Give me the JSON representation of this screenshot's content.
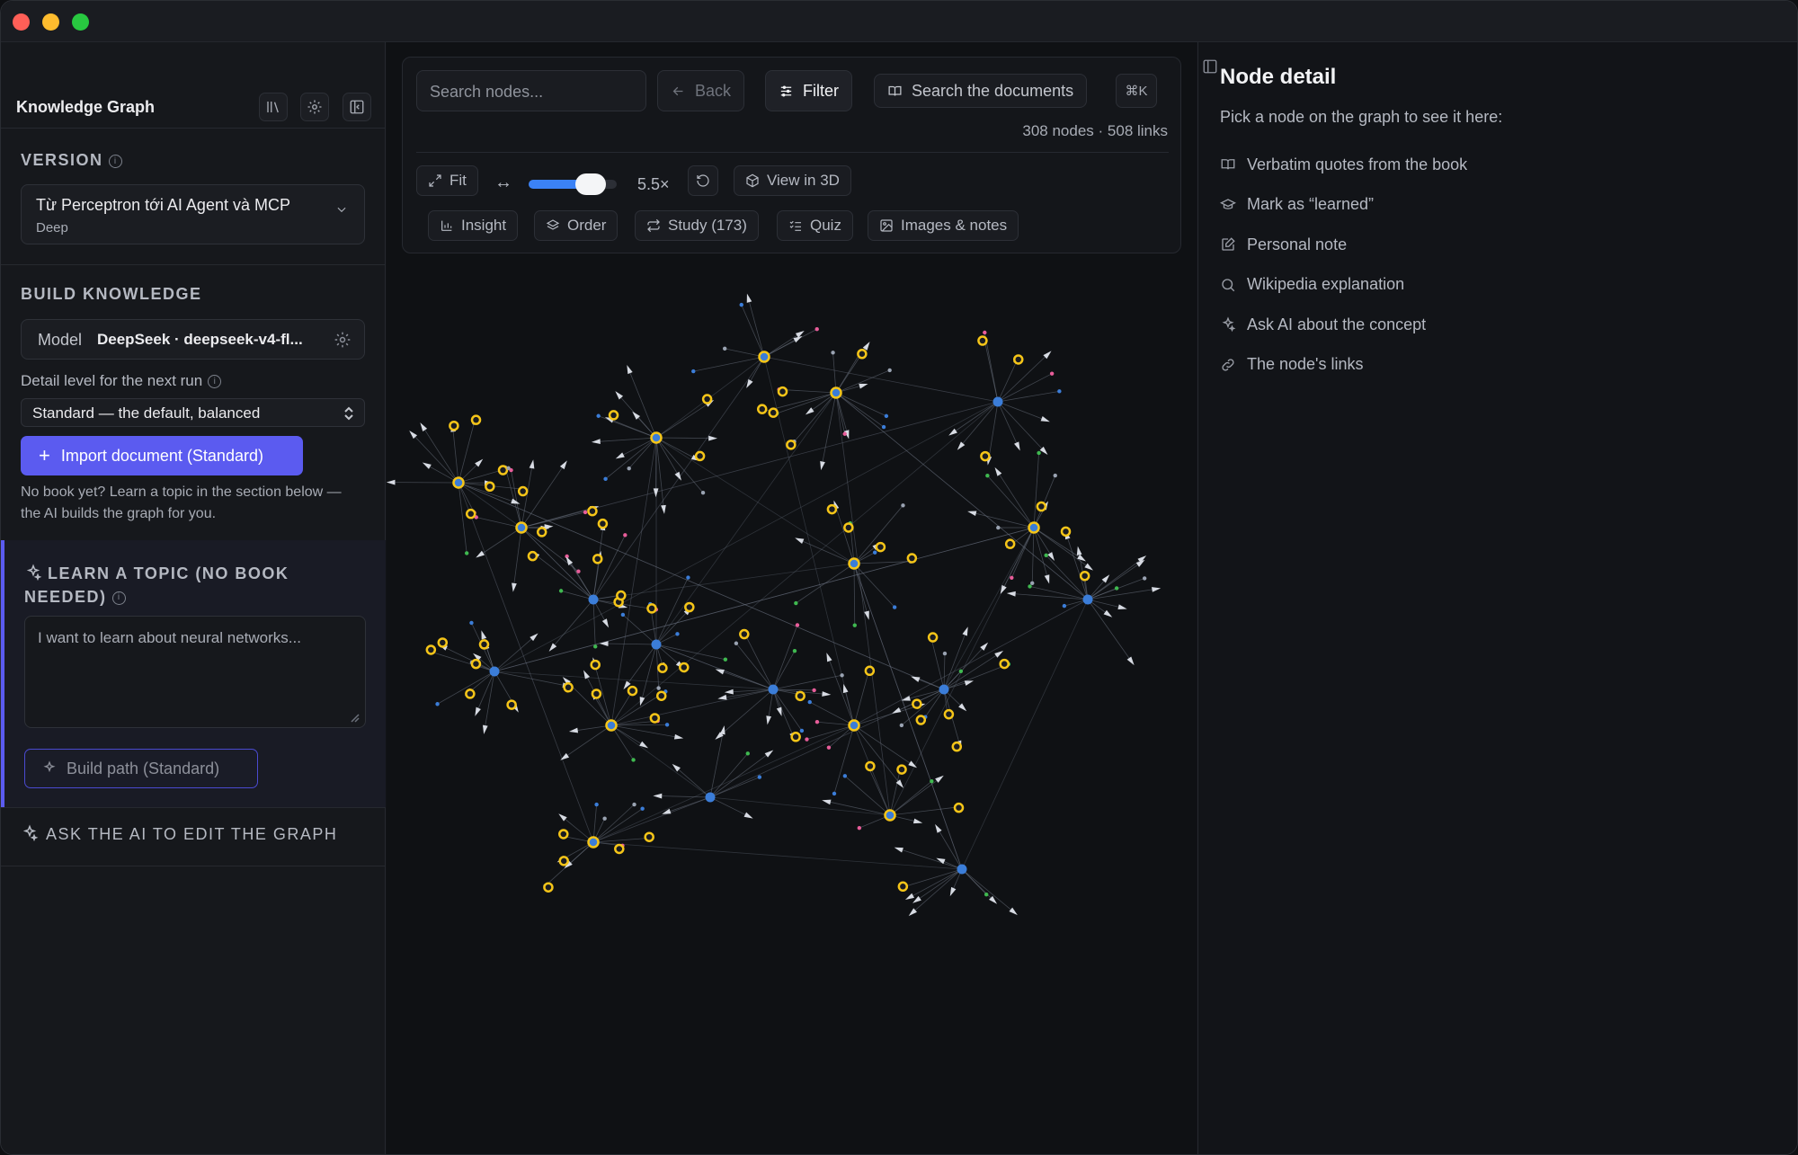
{
  "sidebar": {
    "title": "Knowledge Graph",
    "version_label": "VERSION",
    "version_name": "Từ Perceptron tới AI Agent và MCP",
    "version_depth": "Deep",
    "build_label": "BUILD KNOWLEDGE",
    "model_label": "Model",
    "model_value": "DeepSeek · deepseek-v4-fl...",
    "detail_label": "Detail level for the next run",
    "detail_value": "Standard — the default, balanced",
    "import_label": "Import document (Standard)",
    "nobook_text": "No book yet? Learn a topic in the section below — the AI builds the graph for you.",
    "learn_label": "LEARN A TOPIC (NO BOOK NEEDED)",
    "learn_placeholder": "I want to learn about neural networks...",
    "build_path_label": "Build path (Standard)",
    "ask_ai_label": "ASK THE AI TO EDIT THE GRAPH"
  },
  "toolbar": {
    "search_placeholder": "Search nodes...",
    "back_label": "Back",
    "filter_label": "Filter",
    "search_docs_label": "Search the documents",
    "shortcut": "⌘K",
    "stats": "308 nodes · 508 links",
    "fit_label": "Fit",
    "zoom": "5.5×",
    "zoom_fraction": 0.7,
    "view3d_label": "View in 3D",
    "insight_label": "Insight",
    "order_label": "Order",
    "study_label": "Study (173)",
    "quiz_label": "Quiz",
    "images_label": "Images & notes"
  },
  "node_detail": {
    "title": "Node detail",
    "subtitle": "Pick a node on the graph to see it here:",
    "items": [
      {
        "label": "Verbatim quotes from the book",
        "icon": "book-icon"
      },
      {
        "label": "Mark as “learned”",
        "icon": "graduation-cap-icon"
      },
      {
        "label": "Personal note",
        "icon": "note-edit-icon"
      },
      {
        "label": "Wikipedia explanation",
        "icon": "search-icon"
      },
      {
        "label": "Ask AI about the concept",
        "icon": "sparkles-icon"
      },
      {
        "label": "The node's links",
        "icon": "link-icon"
      }
    ]
  },
  "colors": {
    "accent": "#5b5bf0",
    "highlight_node": "#f5c518",
    "node_blue": "#3b7dd8",
    "node_green": "#3fb950",
    "node_pink": "#e85d9a",
    "edge": "#6b7280"
  }
}
